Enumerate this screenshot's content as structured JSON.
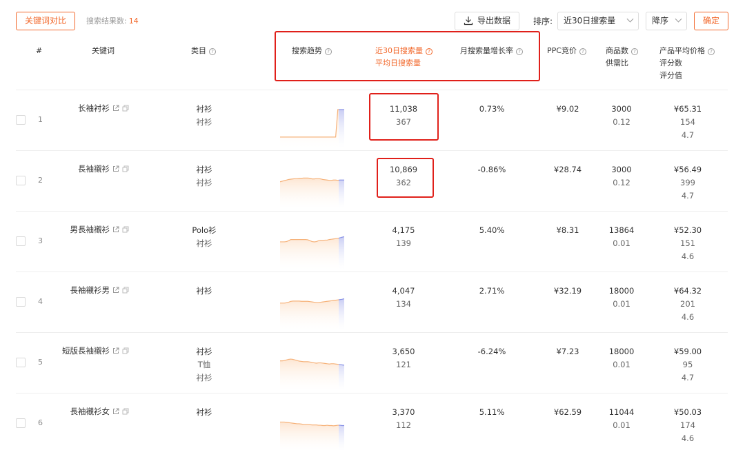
{
  "toolbar": {
    "compare_label": "关键词对比",
    "result_label": "搜索结果数:",
    "result_count": "14",
    "export_label": "导出数据",
    "sort_label": "排序:",
    "sort_value": "近30日搜索量",
    "order_value": "降序",
    "confirm_label": "确定"
  },
  "colors": {
    "accent": "#f2672a",
    "highlight": "#e0201a",
    "spark_fill": "#fde6d2",
    "spark_line": "#f6b27a",
    "spark_recent": "#c9cdf4"
  },
  "headers": {
    "index": "#",
    "keyword": "关键词",
    "category": "类目",
    "trend": "搜索趋势",
    "search30": "近30日搜索量",
    "daily_avg": "平均日搜索量",
    "growth": "月搜索量增长率",
    "ppc": "PPC竞价",
    "products": "商品数",
    "supply_ratio": "供需比",
    "avg_price": "产品平均价格",
    "rating_count": "评分数",
    "rating_value": "评分值"
  },
  "rows": [
    {
      "index": "1",
      "keyword": "长袖衬衫",
      "categories": [
        "衬衫",
        "衬衫"
      ],
      "search30": "11,038",
      "daily": "367",
      "growth": "0.73%",
      "ppc": "¥9.02",
      "products": "3000",
      "ratio": "0.12",
      "price": "¥65.31",
      "rating_count": "154",
      "rating": "4.7",
      "trend": [
        5,
        5,
        5,
        5,
        5,
        5,
        5,
        5,
        5,
        5,
        5,
        5,
        5,
        5,
        5,
        5,
        5,
        5,
        5,
        5,
        5,
        5,
        5,
        5,
        5,
        5,
        5,
        100,
        100,
        100,
        100
      ]
    },
    {
      "index": "2",
      "keyword": "長袖襯衫",
      "categories": [
        "衬衫",
        "衬衫"
      ],
      "search30": "10,869",
      "daily": "362",
      "growth": "-0.86%",
      "ppc": "¥28.74",
      "products": "3000",
      "ratio": "0.12",
      "price": "¥56.49",
      "rating_count": "399",
      "rating": "4.7",
      "trend": [
        60,
        62,
        64,
        66,
        68,
        69,
        70,
        71,
        71,
        72,
        72,
        73,
        73,
        73,
        72,
        70,
        70,
        71,
        71,
        70,
        68,
        67,
        66,
        65,
        65,
        66,
        66,
        65,
        66,
        66,
        66
      ]
    },
    {
      "index": "3",
      "keyword": "男長袖襯衫",
      "categories": [
        "Polo衫",
        "衬衫"
      ],
      "search30": "4,175",
      "daily": "139",
      "growth": "5.40%",
      "ppc": "¥8.31",
      "products": "13864",
      "ratio": "0.01",
      "price": "¥52.30",
      "rating_count": "151",
      "rating": "4.6",
      "trend": [
        62,
        62,
        62,
        63,
        66,
        70,
        70,
        70,
        70,
        70,
        70,
        70,
        70,
        69,
        66,
        63,
        62,
        63,
        66,
        67,
        67,
        68,
        68,
        70,
        71,
        72,
        73,
        74,
        76,
        78,
        80
      ]
    },
    {
      "index": "4",
      "keyword": "長袖襯衫男",
      "categories": [
        "衬衫"
      ],
      "search30": "4,047",
      "daily": "134",
      "growth": "2.71%",
      "ppc": "¥32.19",
      "products": "18000",
      "ratio": "0.01",
      "price": "¥64.32",
      "rating_count": "201",
      "rating": "4.6",
      "trend": [
        60,
        60,
        60,
        61,
        63,
        66,
        67,
        67,
        67,
        67,
        66,
        66,
        66,
        66,
        65,
        64,
        63,
        62,
        62,
        63,
        64,
        65,
        66,
        67,
        68,
        69,
        70,
        71,
        72,
        73,
        75
      ]
    },
    {
      "index": "5",
      "keyword": "短版長袖襯衫",
      "categories": [
        "衬衫",
        "T恤",
        "衬衫"
      ],
      "search30": "3,650",
      "daily": "121",
      "growth": "-6.24%",
      "ppc": "¥7.23",
      "products": "18000",
      "ratio": "0.01",
      "price": "¥59.00",
      "rating_count": "95",
      "rating": "4.7",
      "trend": [
        70,
        70,
        71,
        73,
        75,
        76,
        75,
        73,
        71,
        69,
        68,
        67,
        67,
        67,
        66,
        64,
        63,
        62,
        63,
        63,
        62,
        61,
        60,
        59,
        60,
        60,
        59,
        58,
        57,
        56,
        55
      ]
    },
    {
      "index": "6",
      "keyword": "長袖襯衫女",
      "categories": [
        "衬衫"
      ],
      "search30": "3,370",
      "daily": "112",
      "growth": "5.11%",
      "ppc": "¥62.59",
      "products": "11044",
      "ratio": "0.01",
      "price": "¥50.03",
      "rating_count": "174",
      "rating": "4.6",
      "trend": [
        68,
        68,
        68,
        67,
        66,
        65,
        64,
        63,
        62,
        62,
        61,
        60,
        60,
        60,
        59,
        58,
        58,
        58,
        57,
        57,
        56,
        56,
        57,
        56,
        56,
        55,
        56,
        57,
        57,
        56,
        56
      ]
    }
  ]
}
